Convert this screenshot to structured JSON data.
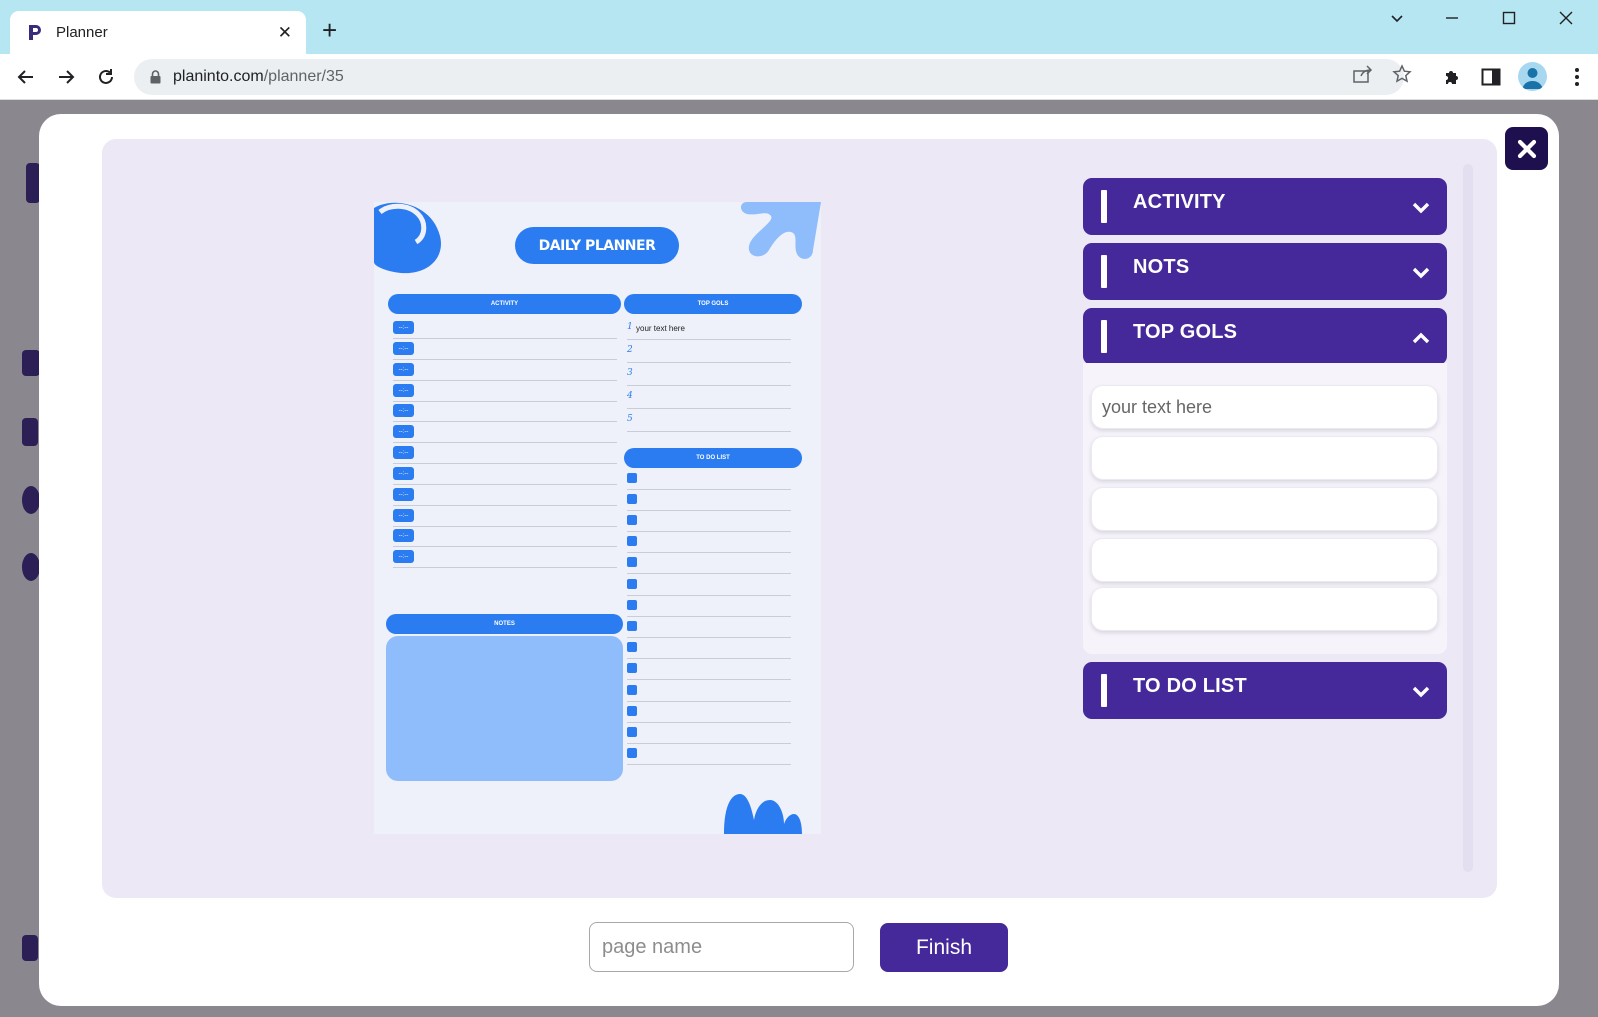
{
  "browser": {
    "tab_title": "Planner",
    "url_domain": "planinto.com",
    "url_path": "/planner/35"
  },
  "planner": {
    "title": "DAILY PLANNER",
    "activity_header": "ACTIVITY",
    "top_goals_header": "TOP GOLS",
    "todo_header": "TO DO LIST",
    "notes_header": "NOTES",
    "activity_chip": "--:--",
    "goals": [
      {
        "num": "1",
        "text": "your text here"
      },
      {
        "num": "2",
        "text": ""
      },
      {
        "num": "3",
        "text": ""
      },
      {
        "num": "4",
        "text": ""
      },
      {
        "num": "5",
        "text": ""
      }
    ]
  },
  "accordion": {
    "sections": [
      {
        "label": "ACTIVITY",
        "expanded": false
      },
      {
        "label": "NOTS",
        "expanded": false
      },
      {
        "label": "TOP GOLS",
        "expanded": true
      },
      {
        "label": "TO DO LIST",
        "expanded": false
      }
    ],
    "goal_inputs": [
      "",
      "",
      "",
      "",
      ""
    ],
    "goal_placeholder": "your text here"
  },
  "footer": {
    "page_name_placeholder": "page name",
    "finish_label": "Finish"
  },
  "colors": {
    "accent_purple": "#452899",
    "planner_blue": "#2a7cf0",
    "workspace_bg": "#ede8f5"
  }
}
